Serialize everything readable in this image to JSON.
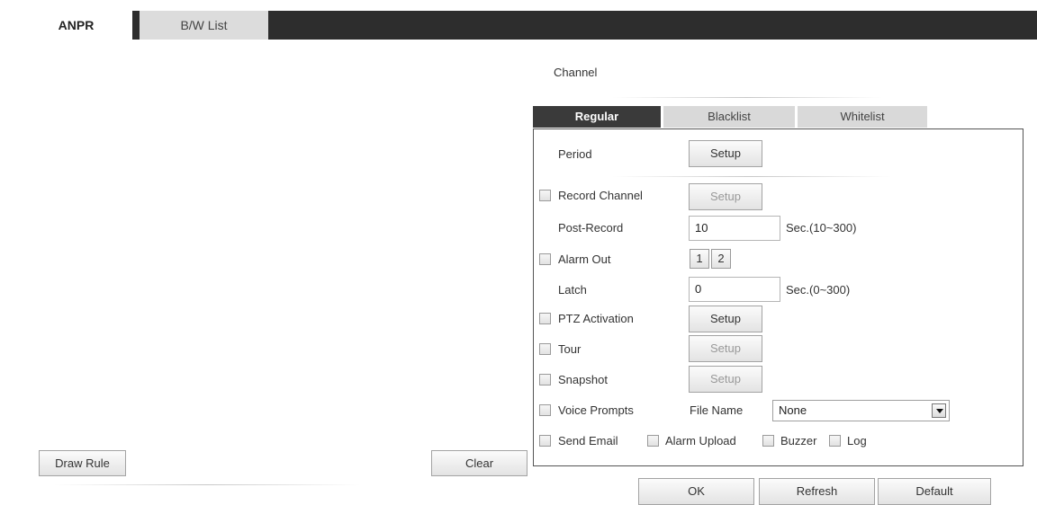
{
  "tabs": {
    "anpr": "ANPR",
    "bw_list": "B/W List"
  },
  "left": {
    "draw_rule": "Draw Rule",
    "clear": "Clear"
  },
  "channel_label": "Channel",
  "subtabs": {
    "regular": "Regular",
    "blacklist": "Blacklist",
    "whitelist": "Whitelist"
  },
  "form": {
    "period_label": "Period",
    "setup_label": "Setup",
    "record_channel_label": "Record Channel",
    "post_record_label": "Post-Record",
    "post_record_value": "10",
    "post_record_unit": "Sec.(10~300)",
    "alarm_out_label": "Alarm Out",
    "alarm_out_ch1": "1",
    "alarm_out_ch2": "2",
    "latch_label": "Latch",
    "latch_value": "0",
    "latch_unit": "Sec.(0~300)",
    "ptz_label": "PTZ Activation",
    "tour_label": "Tour",
    "snapshot_label": "Snapshot",
    "voice_label": "Voice Prompts",
    "file_name_label": "File Name",
    "file_name_value": "None",
    "send_email_label": "Send Email",
    "alarm_upload_label": "Alarm Upload",
    "buzzer_label": "Buzzer",
    "log_label": "Log"
  },
  "footer": {
    "ok": "OK",
    "refresh": "Refresh",
    "default": "Default"
  },
  "icons": {
    "dropdown": "chevron-down-icon",
    "checkbox": "checkbox-icon"
  }
}
